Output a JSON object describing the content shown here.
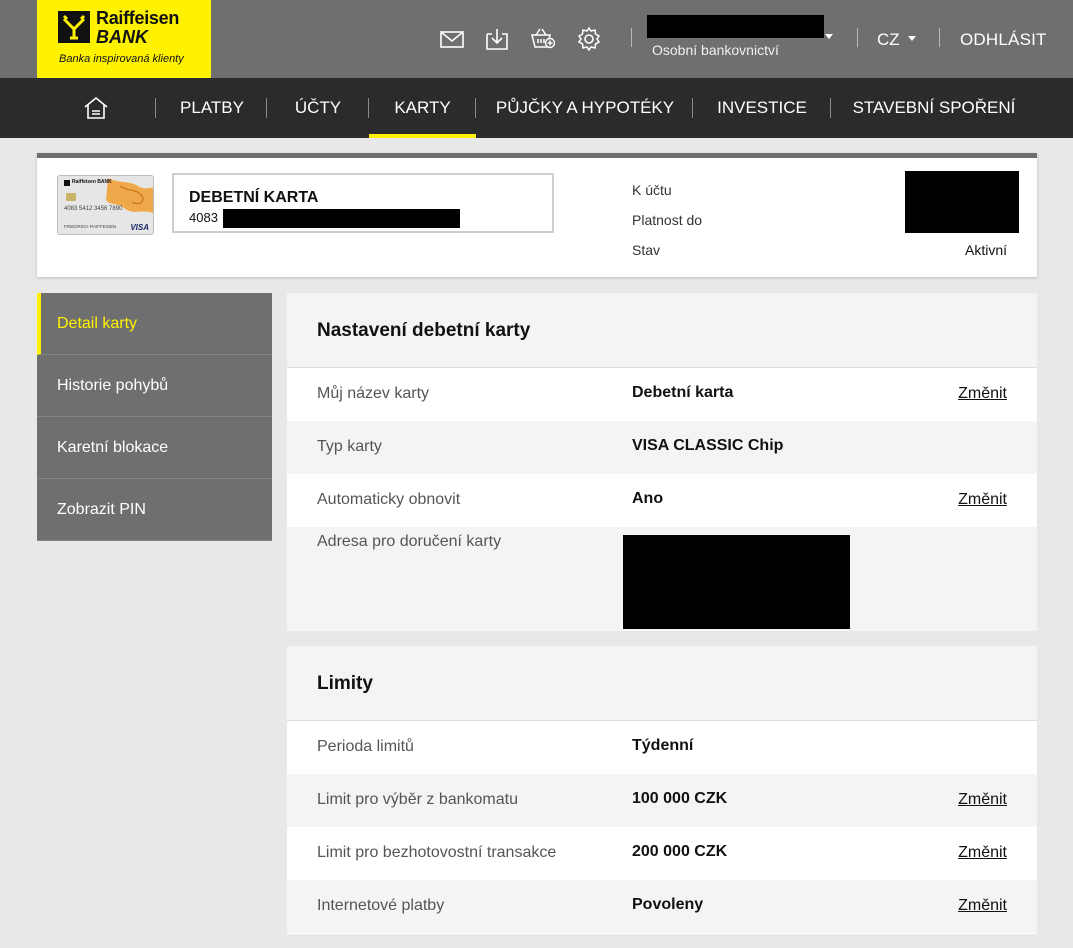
{
  "brand": {
    "name_line1": "Raiffeisen",
    "name_line2": "BANK",
    "tagline": "Banka inspirovaná klienty",
    "accent_color": "#fff200"
  },
  "topbar": {
    "icons": [
      "mail-icon",
      "download-icon",
      "basket-add-icon",
      "gear-icon"
    ],
    "user_subtitle": "Osobní bankovnictví",
    "language": "CZ",
    "logout_label": "ODHLÁSIT"
  },
  "nav": {
    "home_icon": "home-icon",
    "items": [
      {
        "label": "PLATBY"
      },
      {
        "label": "ÚČTY"
      },
      {
        "label": "KARTY"
      },
      {
        "label": "PŮJČKY A HYPOTÉKY"
      },
      {
        "label": "INVESTICE"
      },
      {
        "label": "STAVEBNÍ SPOŘENÍ"
      }
    ],
    "active": "KARTY"
  },
  "card": {
    "title": "DEBETNÍ KARTA",
    "number_prefix": "4083",
    "meta": {
      "account_label": "K účtu",
      "validity_label": "Platnost do",
      "status_label": "Stav",
      "status_value": "Aktivní"
    },
    "thumb": {
      "brand_text": "Raiffeisen BANK",
      "number_text": "4083 5412 3456 7890",
      "holder_text": "FRIEDRICH RAIFFEISEN",
      "network": "VISA"
    }
  },
  "sidebar": {
    "items": [
      {
        "label": "Detail karty"
      },
      {
        "label": "Historie pohybů"
      },
      {
        "label": "Karetní blokace"
      },
      {
        "label": "Zobrazit PIN"
      }
    ]
  },
  "settings": {
    "heading": "Nastavení debetní karty",
    "rows": [
      {
        "label": "Můj název karty",
        "value": "Debetní karta",
        "action": "Změnit"
      },
      {
        "label": "Typ karty",
        "value": "VISA CLASSIC Chip"
      },
      {
        "label": "Automaticky obnovit",
        "value": "Ano",
        "action": "Změnit"
      },
      {
        "label": "Adresa pro doručení karty"
      }
    ]
  },
  "limits": {
    "heading": "Limity",
    "rows": [
      {
        "label": "Perioda limitů",
        "value": "Týdenní"
      },
      {
        "label": "Limit pro výběr z bankomatu",
        "value": "100 000 CZK",
        "action": "Změnit"
      },
      {
        "label": "Limit pro bezhotovostní transakce",
        "value": "200 000 CZK",
        "action": "Změnit"
      },
      {
        "label": "Internetové platby",
        "value": "Povoleny",
        "action": "Změnit"
      }
    ]
  }
}
